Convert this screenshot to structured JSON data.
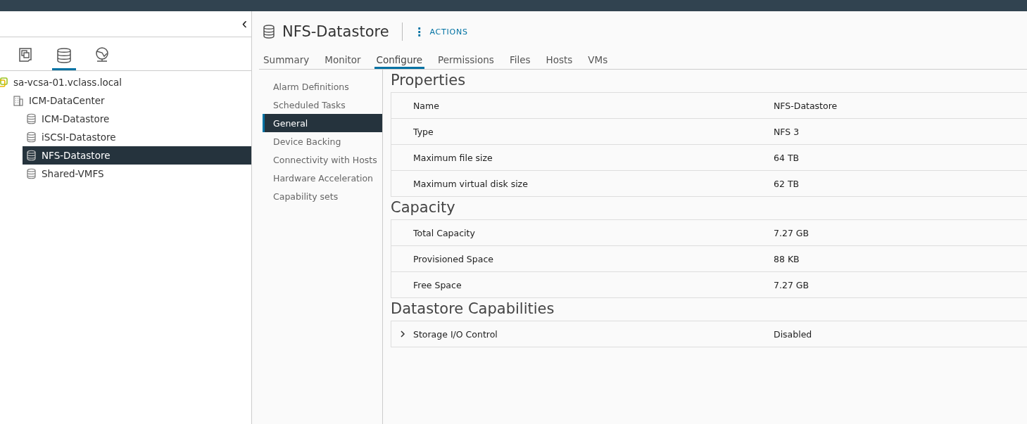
{
  "sidebar": {
    "collapse_glyph": "‹",
    "icon_tabs": [
      {
        "kind": "hosts",
        "selected": false
      },
      {
        "kind": "storage",
        "selected": true
      },
      {
        "kind": "network",
        "selected": false
      }
    ],
    "tree": [
      {
        "label": "sa-vcsa-01.vclass.local",
        "kind": "vcenter",
        "selected": false,
        "children": [
          {
            "label": "ICM-DataCenter",
            "kind": "datacenter",
            "selected": false,
            "children": [
              {
                "label": "ICM-Datastore",
                "kind": "datastore",
                "selected": false
              },
              {
                "label": "iSCSI-Datastore",
                "kind": "datastore",
                "selected": false
              },
              {
                "label": "NFS-Datastore",
                "kind": "datastore",
                "selected": true
              },
              {
                "label": "Shared-VMFS",
                "kind": "datastore",
                "selected": false
              }
            ]
          }
        ]
      }
    ]
  },
  "header": {
    "title": "NFS-Datastore",
    "actions_glyph": "⋮",
    "actions": "ACTIONS"
  },
  "tabs": [
    {
      "label": "Summary",
      "selected": false
    },
    {
      "label": "Monitor",
      "selected": false
    },
    {
      "label": "Configure",
      "selected": true
    },
    {
      "label": "Permissions",
      "selected": false
    },
    {
      "label": "Files",
      "selected": false
    },
    {
      "label": "Hosts",
      "selected": false
    },
    {
      "label": "VMs",
      "selected": false
    }
  ],
  "subnav": [
    {
      "label": "Alarm Definitions",
      "selected": false
    },
    {
      "label": "Scheduled Tasks",
      "selected": false
    },
    {
      "label": "General",
      "selected": true
    },
    {
      "label": "Device Backing",
      "selected": false
    },
    {
      "label": "Connectivity with Hosts",
      "selected": false
    },
    {
      "label": "Hardware Acceleration",
      "selected": false
    },
    {
      "label": "Capability sets",
      "selected": false
    }
  ],
  "sections": [
    {
      "title": "Properties",
      "rows": [
        {
          "label": "Name",
          "value": "NFS-Datastore"
        },
        {
          "label": "Type",
          "value": "NFS 3"
        },
        {
          "label": "Maximum file size",
          "value": "64 TB"
        },
        {
          "label": "Maximum virtual disk size",
          "value": "62 TB"
        }
      ]
    },
    {
      "title": "Capacity",
      "rows": [
        {
          "label": "Total Capacity",
          "value": "7.27 GB"
        },
        {
          "label": "Provisioned Space",
          "value": "88 KB"
        },
        {
          "label": "Free Space",
          "value": "7.27 GB"
        }
      ]
    },
    {
      "title": "Datastore Capabilities",
      "rows": [
        {
          "label": "Storage I/O Control",
          "value": "Disabled",
          "expanded": false
        }
      ]
    }
  ]
}
